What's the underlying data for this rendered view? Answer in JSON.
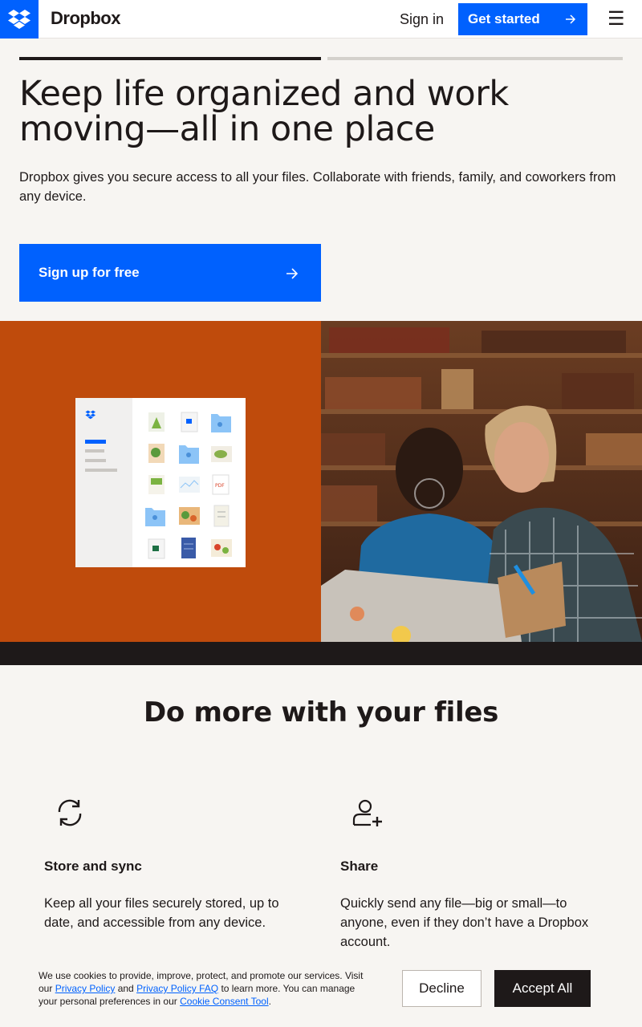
{
  "header": {
    "brand": "Dropbox",
    "sign_in": "Sign in",
    "get_started": "Get started",
    "menu_icon": "hamburger-icon"
  },
  "hero": {
    "progress": [
      1.0,
      0.0
    ],
    "title": "Keep life organized and work moving—all in one place",
    "subtitle": "Dropbox gives you secure access to all your files. Collaborate with friends, family, and coworkers from any device.",
    "cta": "Sign up for free"
  },
  "features": {
    "title": "Do more with your files",
    "items": [
      {
        "icon": "sync-icon",
        "title": "Store and sync",
        "text": "Keep all your files securely stored, up to date, and accessible from any device."
      },
      {
        "icon": "add-user-icon",
        "title": "Share",
        "text": "Quickly send any file—big or small—to anyone, even if they don’t have a Dropbox account."
      }
    ]
  },
  "cookie": {
    "text_1": "We use cookies to provide, improve, protect, and promote our services. Visit our ",
    "link_privacy": "Privacy Policy",
    "text_2": " and ",
    "link_faq": "Privacy Policy FAQ",
    "text_3": " to learn more. You can manage your personal preferences in our ",
    "link_tool": "Cookie Consent Tool",
    "text_4": ".",
    "decline": "Decline",
    "accept": "Accept All"
  },
  "colors": {
    "accent": "#0061fe",
    "dark": "#1e1919",
    "orange": "#bf4b0c",
    "background": "#f7f5f2"
  }
}
